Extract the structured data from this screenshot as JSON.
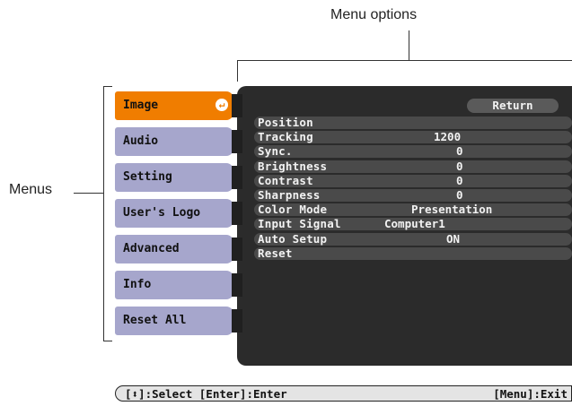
{
  "callouts": {
    "menu_options": "Menu options",
    "menus": "Menus"
  },
  "menus": [
    {
      "label": "Image",
      "active": true
    },
    {
      "label": "Audio",
      "active": false
    },
    {
      "label": "Setting",
      "active": false
    },
    {
      "label": "User's Logo",
      "active": false
    },
    {
      "label": "Advanced",
      "active": false
    },
    {
      "label": "Info",
      "active": false
    },
    {
      "label": "Reset All",
      "active": false
    }
  ],
  "panel": {
    "return_label": "Return",
    "options": [
      {
        "label": "Position",
        "value": ""
      },
      {
        "label": "Tracking",
        "value": "1200"
      },
      {
        "label": "Sync.",
        "value": "0"
      },
      {
        "label": "Brightness",
        "value": "0"
      },
      {
        "label": "Contrast",
        "value": "0"
      },
      {
        "label": "Sharpness",
        "value": "0"
      },
      {
        "label": "Color Mode",
        "value": "Presentation"
      },
      {
        "label": "Input Signal",
        "value": "Computer1"
      },
      {
        "label": "Auto Setup",
        "value": "ON"
      },
      {
        "label": "Reset",
        "value": ""
      }
    ]
  },
  "status_bar": {
    "left": "[⬍]:Select [Enter]:Enter",
    "right": "[Menu]:Exit"
  },
  "colors": {
    "active_menu": "#f07d00",
    "menu": "#a6a6cc",
    "panel": "#2b2b2b"
  }
}
